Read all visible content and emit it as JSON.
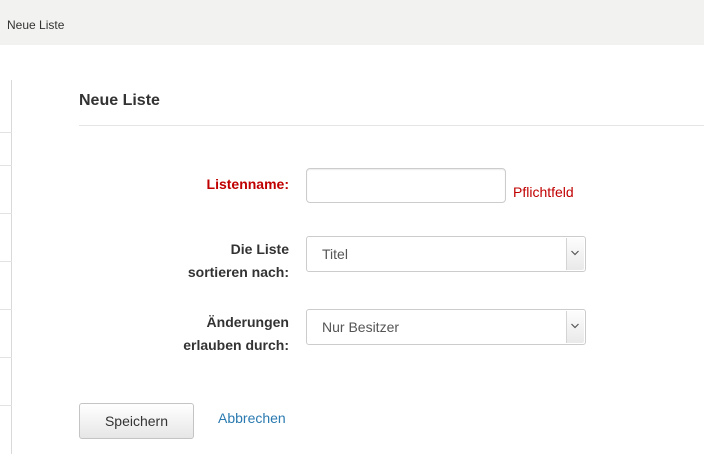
{
  "header": {
    "title": "Neue Liste"
  },
  "panel": {
    "title": "Neue Liste"
  },
  "form": {
    "name_label": "Listenname:",
    "name_value": "",
    "name_hint": "Pflichtfeld",
    "sort_label": "Die Liste\nsortieren nach:",
    "sort_value": "Titel",
    "perm_label": "Änderungen\nerlauben durch:",
    "perm_value": "Nur Besitzer"
  },
  "actions": {
    "save_label": "Speichern",
    "cancel_label": "Abbrechen"
  },
  "icons": {
    "dropdown": "chevron-down-icon"
  },
  "colors": {
    "required": "#c00000",
    "link": "#2a7ab0"
  }
}
